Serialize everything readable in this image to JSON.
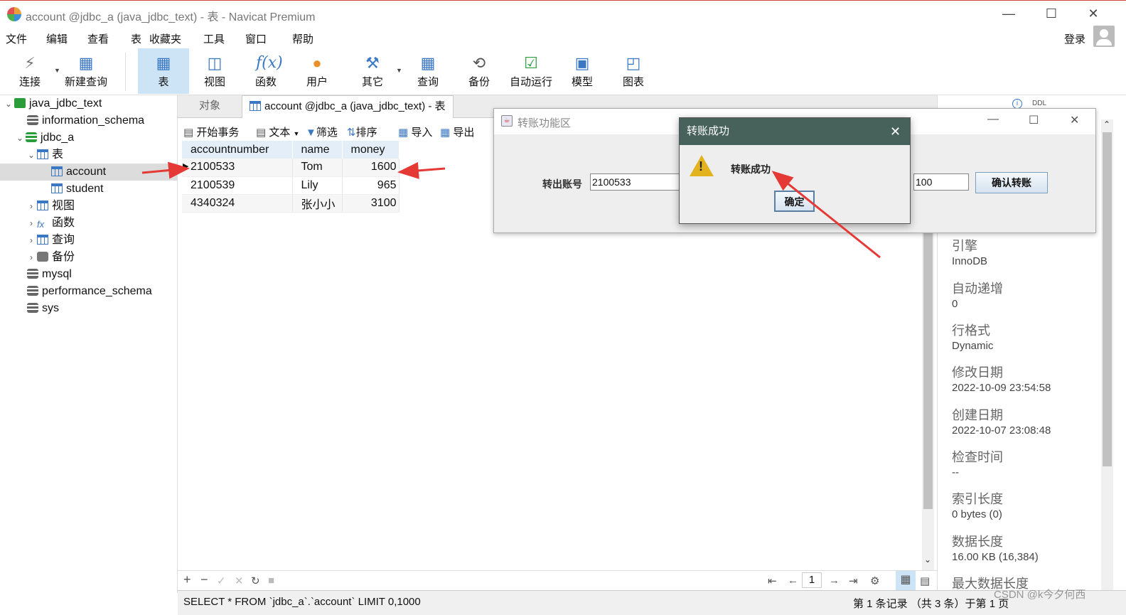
{
  "window": {
    "title": "account @jdbc_a (java_jdbc_text) - 表 - Navicat Premium",
    "minimize": "—",
    "maximize": "☐",
    "close": "✕"
  },
  "menu": [
    "文件",
    "编辑",
    "查看",
    "表",
    "收藏夹",
    "工具",
    "窗口",
    "帮助"
  ],
  "login": "登录",
  "toolbar": [
    {
      "label": "连接",
      "icon": "plug-icon"
    },
    {
      "label": "新建查询",
      "icon": "new-query-icon"
    },
    {
      "label": "表",
      "icon": "table-icon"
    },
    {
      "label": "视图",
      "icon": "view-icon"
    },
    {
      "label": "函数",
      "icon": "function-icon"
    },
    {
      "label": "用户",
      "icon": "user-icon"
    },
    {
      "label": "其它",
      "icon": "tools-icon"
    },
    {
      "label": "查询",
      "icon": "query-icon"
    },
    {
      "label": "备份",
      "icon": "backup-icon"
    },
    {
      "label": "自动运行",
      "icon": "schedule-icon"
    },
    {
      "label": "模型",
      "icon": "model-icon"
    },
    {
      "label": "图表",
      "icon": "chart-icon"
    }
  ],
  "tree": {
    "connection": "java_jdbc_text",
    "information_schema": "information_schema",
    "db": "jdbc_a",
    "tables": "表",
    "account": "account",
    "student": "student",
    "views": "视图",
    "functions": "函数",
    "queries": "查询",
    "backups": "备份",
    "mysql": "mysql",
    "performance_schema": "performance_schema",
    "sys": "sys"
  },
  "tabs": {
    "objects": "对象",
    "active": "account @jdbc_a (java_jdbc_text) - 表"
  },
  "gridbar": {
    "begin_tx": "开始事务",
    "text": "文本",
    "filter": "筛选",
    "sort": "排序",
    "import": "导入",
    "export": "导出"
  },
  "grid": {
    "columns": [
      "accountnumber",
      "name",
      "money"
    ],
    "rows": [
      [
        "2100533",
        "Tom",
        "1600"
      ],
      [
        "2100539",
        "Lily",
        "965"
      ],
      [
        "4340324",
        "张小小",
        "3100"
      ]
    ]
  },
  "info": [
    {
      "label": "引擎",
      "value": "InnoDB"
    },
    {
      "label": "自动递增",
      "value": "0"
    },
    {
      "label": "行格式",
      "value": "Dynamic"
    },
    {
      "label": "修改日期",
      "value": "2022-10-09 23:54:58"
    },
    {
      "label": "创建日期",
      "value": "2022-10-07 23:08:48"
    },
    {
      "label": "检查时间",
      "value": "--"
    },
    {
      "label": "索引长度",
      "value": "0 bytes (0)"
    },
    {
      "label": "数据长度",
      "value": "16.00 KB (16,384)"
    },
    {
      "label": "最大数据长度",
      "value": ""
    }
  ],
  "gridnav": {
    "page": "1"
  },
  "status": {
    "sql": "SELECT * FROM `jdbc_a`.`account` LIMIT 0,1000",
    "record": "第 1 条记录 （共 3 条）于第 1 页",
    "watermark": "CSDN @k今夕何西"
  },
  "transfer_window": {
    "title": "转账功能区",
    "from_label": "转出账号",
    "from_value": "2100533",
    "amount_value": "100",
    "confirm": "确认转账"
  },
  "dialog": {
    "title": "转账成功",
    "message": "转账成功",
    "ok": "确定"
  },
  "colors": {
    "dialog_title": "#46625a",
    "annotation_arrow": "#e53935",
    "active_tool": "#cde4f7"
  }
}
